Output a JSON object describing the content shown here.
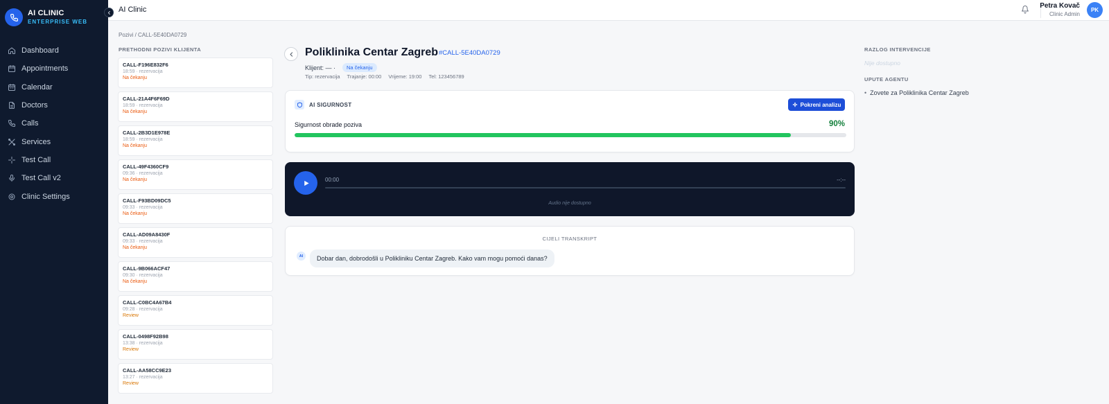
{
  "brand": {
    "title": "AI CLINIC",
    "subtitle": "ENTERPRISE WEB"
  },
  "nav": [
    {
      "label": "Dashboard",
      "icon": "home-icon"
    },
    {
      "label": "Appointments",
      "icon": "calendar-check-icon"
    },
    {
      "label": "Calendar",
      "icon": "calendar-icon"
    },
    {
      "label": "Doctors",
      "icon": "document-icon"
    },
    {
      "label": "Calls",
      "icon": "phone-icon"
    },
    {
      "label": "Services",
      "icon": "tools-icon"
    },
    {
      "label": "Test Call",
      "icon": "sparkle-icon"
    },
    {
      "label": "Test Call v2",
      "icon": "microphone-icon"
    },
    {
      "label": "Clinic Settings",
      "icon": "gear-icon"
    }
  ],
  "topbar": {
    "title": "AI Clinic",
    "user_name": "Petra Kovač",
    "user_role": "Clinic Admin",
    "avatar": "PK"
  },
  "breadcrumb": "Pozivi  /  CALL-5E40DA0729",
  "left_panel": {
    "header": "PRETHODNI POZIVI KLIJENTA",
    "calls": [
      {
        "id": "CALL-F196E832F6",
        "meta": "18:59 · rezervacija",
        "status": "Na čekanju"
      },
      {
        "id": "CALL-21A4F6F69D",
        "meta": "18:59 · rezervacija",
        "status": "Na čekanju"
      },
      {
        "id": "CALL-2B3D1E978E",
        "meta": "18:59 · rezervacija",
        "status": "Na čekanju"
      },
      {
        "id": "CALL-49F4360CF9",
        "meta": "09:36 · rezervacija",
        "status": "Na čekanju"
      },
      {
        "id": "CALL-F93BD09DC5",
        "meta": "09:33 · rezervacija",
        "status": "Na čekanju"
      },
      {
        "id": "CALL-AD09A8430F",
        "meta": "09:33 · rezervacija",
        "status": "Na čekanju"
      },
      {
        "id": "CALL-9B066ACF47",
        "meta": "09:30 · rezervacija",
        "status": "Na čekanju"
      },
      {
        "id": "CALL-C0BC4A67B4",
        "meta": "09:28 · rezervacija",
        "status": "Review"
      },
      {
        "id": "CALL-0498F92B98",
        "meta": "13:38 · rezervacija",
        "status": "Review"
      },
      {
        "id": "CALL-AA58CC9E23",
        "meta": "13:27 · rezervacija",
        "status": "Review"
      }
    ]
  },
  "call": {
    "title": "Poliklinika Centar Zagreb",
    "code": "#CALL-5E40DA0729",
    "client": "Klijent: —  ·",
    "status": "Na čekanju",
    "type": "Tip: rezervacija",
    "duration": "Trajanje: 00:00",
    "time": "Vrijeme: 19:00",
    "phone": "Tel: 123456789"
  },
  "ai_security": {
    "label": "AI SIGURNOST",
    "button": "Pokreni analizu",
    "confidence_label": "Sigurnost obrade poziva",
    "confidence_text": "90%",
    "confidence": 0.9
  },
  "audio": {
    "current": "00:00",
    "end": "--:--",
    "unavailable": "Audio nije dostupno"
  },
  "transcript": {
    "title": "CIJELI TRANSKRIPT",
    "messages": [
      {
        "speaker": "AI",
        "text": "Dobar dan, dobrodošli u Polikliniku Centar Zagreb. Kako vam mogu pomoći danas?"
      }
    ]
  },
  "right_panel": {
    "intervention_title": "RAZLOG INTERVENCIJE",
    "intervention_value": "Nije dostupno",
    "instructions_title": "UPUTE AGENTU",
    "instructions": [
      "Zovete za Poliklinika Centar Zagreb"
    ]
  },
  "colors": {
    "sidebar": "#0f1a2e",
    "accent": "#2563eb",
    "pending": "#ea580c",
    "success": "#22c55e"
  }
}
